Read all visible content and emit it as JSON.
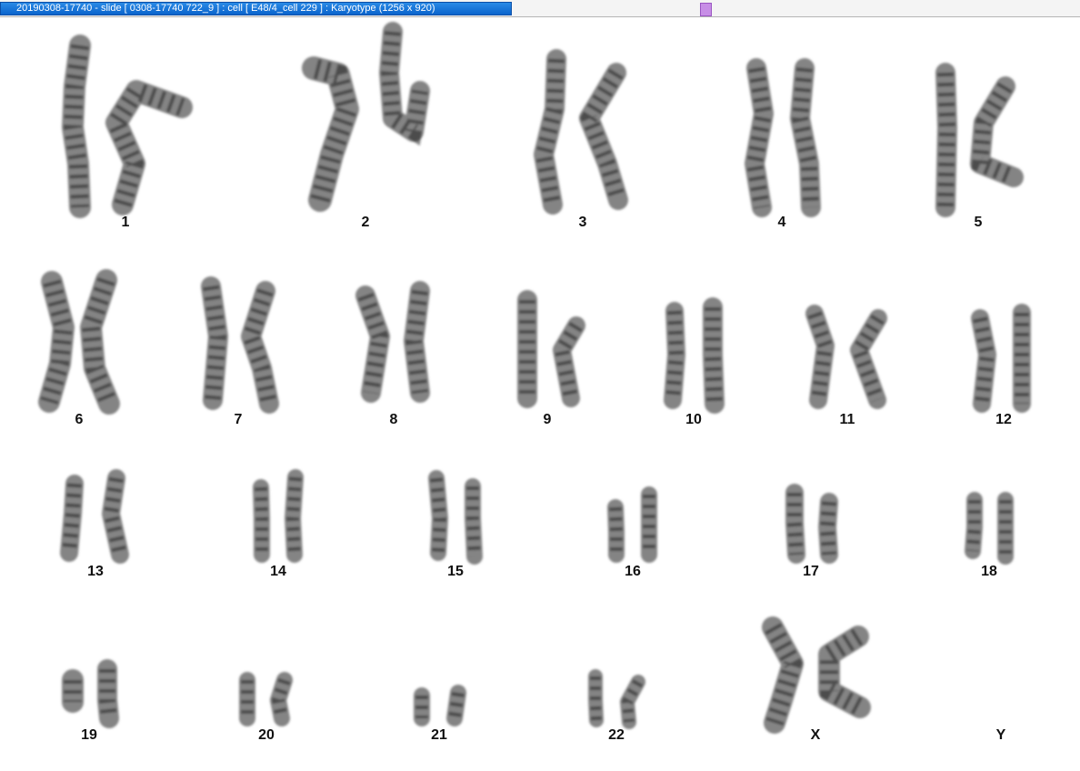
{
  "window": {
    "title": "20190308-17740 - slide [ 0308-17740 722_9 ] : cell [ E48/4_cell 229 ] : Karyotype  (1256 x 920)"
  },
  "karyotype": {
    "chromosomes": [
      {
        "label": "1"
      },
      {
        "label": "2"
      },
      {
        "label": "3"
      },
      {
        "label": "4"
      },
      {
        "label": "5"
      },
      {
        "label": "6"
      },
      {
        "label": "7"
      },
      {
        "label": "8"
      },
      {
        "label": "9"
      },
      {
        "label": "10"
      },
      {
        "label": "11"
      },
      {
        "label": "12"
      },
      {
        "label": "13"
      },
      {
        "label": "14"
      },
      {
        "label": "15"
      },
      {
        "label": "16"
      },
      {
        "label": "17"
      },
      {
        "label": "18"
      },
      {
        "label": "19"
      },
      {
        "label": "20"
      },
      {
        "label": "21"
      },
      {
        "label": "22"
      },
      {
        "label": "X"
      },
      {
        "label": "Y"
      }
    ]
  },
  "colors": {
    "title_bg": "#0a64cc",
    "scroll_thumb": "#c78ee6",
    "chromosome": "#6e6e6e",
    "chromosome_dark": "#1e1e1e"
  }
}
